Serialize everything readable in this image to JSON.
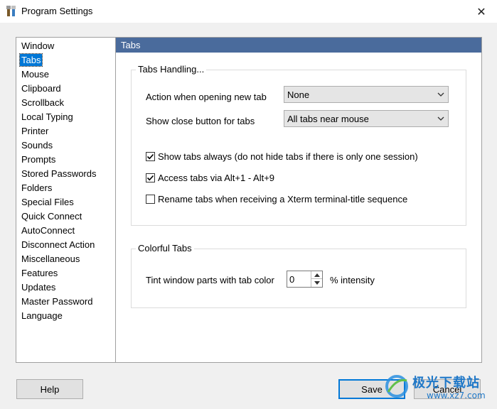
{
  "window": {
    "title": "Program Settings",
    "close_glyph": "✕"
  },
  "sidebar": {
    "items": [
      {
        "label": "Window"
      },
      {
        "label": "Tabs",
        "selected": true
      },
      {
        "label": "Mouse"
      },
      {
        "label": "Clipboard"
      },
      {
        "label": "Scrollback"
      },
      {
        "label": "Local Typing"
      },
      {
        "label": "Printer"
      },
      {
        "label": "Sounds"
      },
      {
        "label": "Prompts"
      },
      {
        "label": "Stored Passwords"
      },
      {
        "label": "Folders"
      },
      {
        "label": "Special Files"
      },
      {
        "label": "Quick Connect"
      },
      {
        "label": "AutoConnect"
      },
      {
        "label": "Disconnect Action"
      },
      {
        "label": "Miscellaneous"
      },
      {
        "label": "Features"
      },
      {
        "label": "Updates"
      },
      {
        "label": "Master Password"
      },
      {
        "label": "Language"
      }
    ]
  },
  "panel": {
    "header": "Tabs",
    "tabs_handling": {
      "title": "Tabs Handling...",
      "action_label": "Action when opening new tab",
      "action_value": "None",
      "close_label": "Show close button for tabs",
      "close_value": "All tabs near mouse",
      "show_always": {
        "label": "Show tabs always (do not hide tabs if there is only one session)",
        "checked": true
      },
      "alt_access": {
        "label": "Access tabs via Alt+1 - Alt+9",
        "checked": true
      },
      "rename": {
        "label": "Rename tabs when receiving a Xterm terminal-title sequence",
        "checked": false
      }
    },
    "colorful_tabs": {
      "title": "Colorful Tabs",
      "tint_label": "Tint window parts with tab color",
      "tint_value": "0",
      "tint_unit": "% intensity"
    }
  },
  "buttons": {
    "help": "Help",
    "save": "Save",
    "cancel": "Cancel"
  },
  "watermark": {
    "line1": "极光下载站",
    "line2": "www.xz7.com"
  },
  "colors": {
    "header_bg": "#4a6b9c",
    "selection": "#0078d7",
    "default_button_border": "#0078d7"
  }
}
